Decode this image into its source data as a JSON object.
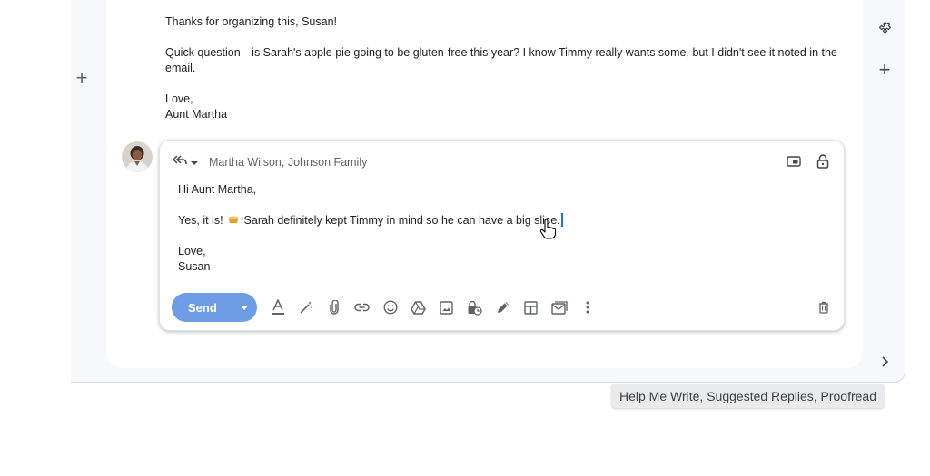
{
  "previous_message": {
    "greeting": "Thanks for organizing this, Susan!",
    "body": "Quick question—is Sarah's apple pie going to be gluten-free this year? I know Timmy really wants some, but I didn't see it noted in the email.",
    "signoff": "Love,",
    "signature": "Aunt Martha"
  },
  "compose": {
    "recipients": "Martha Wilson, Johnson Family",
    "greeting": "Hi Aunt Martha,",
    "body_start": "Yes, it is!",
    "body_end": "Sarah definitely kept Timmy in mind so he can have a big slice.",
    "signoff": "Love,",
    "signature": "Susan",
    "send_label": "Send"
  },
  "toolbar_icons": [
    "formatting-icon",
    "magic-wand-icon",
    "attachment-icon",
    "link-icon",
    "emoji-icon",
    "drive-icon",
    "photo-icon",
    "confidential-mode-icon",
    "signature-icon",
    "layout-icon",
    "template-icon",
    "more-options-icon"
  ],
  "tooltip": "Help Me Write, Suggested Replies, Proofread",
  "colors": {
    "send_button": "#6e9de6",
    "caret": "#1a73e8",
    "frame_bg": "#f6f8fc"
  }
}
